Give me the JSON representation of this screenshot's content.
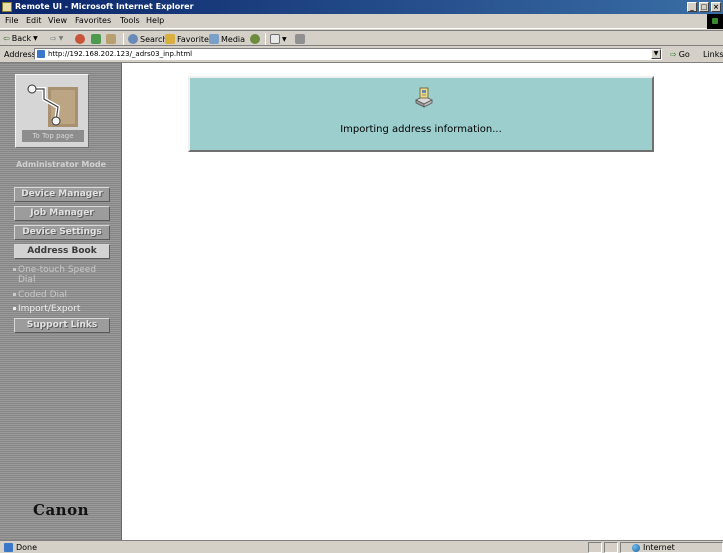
{
  "window": {
    "title": "Remote UI - Microsoft Internet Explorer",
    "minimize_glyph": "_",
    "restore_glyph": "□",
    "close_glyph": "×"
  },
  "menu": {
    "items": [
      "File",
      "Edit",
      "View",
      "Favorites",
      "Tools",
      "Help"
    ]
  },
  "toolbar": {
    "back_label": "Back",
    "search_label": "Search",
    "favorites_label": "Favorites",
    "media_label": "Media"
  },
  "address": {
    "label": "Address",
    "url": "http://192.168.202.123/_adrs03_inp.html",
    "go_label": "Go",
    "links_label": "Links"
  },
  "sidebar": {
    "top_page_label": "To Top page",
    "mode_label": "Administrator Mode",
    "nav": [
      "Device Manager",
      "Job Manager",
      "Device Settings",
      "Address Book"
    ],
    "address_book_items": [
      "One-touch Speed Dial",
      "Coded Dial",
      "Import/Export"
    ],
    "support_label": "Support Links",
    "brand": "Canon"
  },
  "main": {
    "message": "Importing address information..."
  },
  "status": {
    "text": "Done",
    "zone": "Internet"
  },
  "colors": {
    "titlebar_start": "#0a246a",
    "message_box_bg": "#9ccece",
    "sidebar_bg": "#8e8e8e"
  }
}
